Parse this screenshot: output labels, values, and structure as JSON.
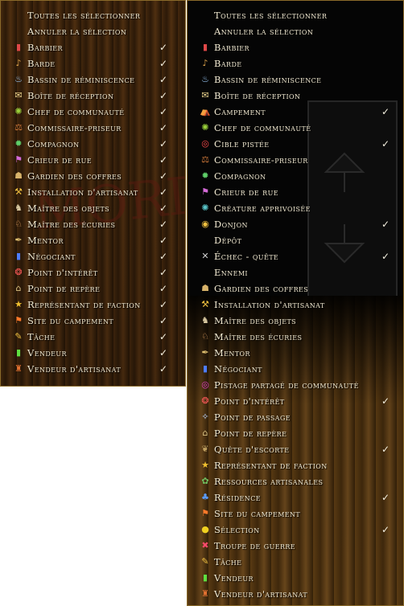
{
  "left_menu": {
    "watermark": "MORDOR",
    "items": [
      {
        "label": "Toutes les sélectionner",
        "icon": "none",
        "checked": false
      },
      {
        "label": "Annuler la sélection",
        "icon": "none",
        "checked": false
      },
      {
        "label": "Barbier",
        "icon": "barber-pole-icon",
        "checked": true
      },
      {
        "label": "Barde",
        "icon": "lute-icon",
        "checked": true
      },
      {
        "label": "Bassin de réminiscence",
        "icon": "reflecting-pool-icon",
        "checked": true
      },
      {
        "label": "Boîte de réception",
        "icon": "mailbox-icon",
        "checked": true
      },
      {
        "label": "Chef de communauté",
        "icon": "kinship-leader-icon",
        "checked": true
      },
      {
        "label": "Commissaire-priseur",
        "icon": "auctioneer-icon",
        "checked": true
      },
      {
        "label": "Compagnon",
        "icon": "companion-icon",
        "checked": true
      },
      {
        "label": "Crieur de rue",
        "icon": "town-crier-icon",
        "checked": true
      },
      {
        "label": "Gardien des coffres",
        "icon": "vault-keeper-icon",
        "checked": true
      },
      {
        "label": "Installation d'artisanat",
        "icon": "crafting-facility-icon",
        "checked": true
      },
      {
        "label": "Maître des objets",
        "icon": "item-master-icon",
        "checked": true
      },
      {
        "label": "Maître des écuries",
        "icon": "stable-master-icon",
        "checked": true
      },
      {
        "label": "Mentor",
        "icon": "mentor-icon",
        "checked": true
      },
      {
        "label": "Négociant",
        "icon": "merchant-icon",
        "checked": true
      },
      {
        "label": "Point d'intérêt",
        "icon": "point-of-interest-icon",
        "checked": true
      },
      {
        "label": "Point de repère",
        "icon": "landmark-icon",
        "checked": true
      },
      {
        "label": "Représentant de faction",
        "icon": "faction-star-icon",
        "checked": true
      },
      {
        "label": "Site du campement",
        "icon": "campsite-icon",
        "checked": true
      },
      {
        "label": "Tâche",
        "icon": "task-quill-icon",
        "checked": true
      },
      {
        "label": "Vendeur",
        "icon": "vendor-icon",
        "checked": true
      },
      {
        "label": "Vendeur d'artisanat",
        "icon": "crafting-vendor-icon",
        "checked": true
      }
    ]
  },
  "right_menu": {
    "items": [
      {
        "label": "Toutes les sélectionner",
        "icon": "none",
        "checked": false
      },
      {
        "label": "Annuler la sélection",
        "icon": "none",
        "checked": false
      },
      {
        "label": "Barbier",
        "icon": "barber-pole-icon",
        "checked": false
      },
      {
        "label": "Barde",
        "icon": "lute-icon",
        "checked": false
      },
      {
        "label": "Bassin de réminiscence",
        "icon": "reflecting-pool-icon",
        "checked": false
      },
      {
        "label": "Boîte de réception",
        "icon": "mailbox-icon",
        "checked": false
      },
      {
        "label": "Campement",
        "icon": "encampment-icon",
        "checked": true
      },
      {
        "label": "Chef de communauté",
        "icon": "kinship-leader-icon",
        "checked": false
      },
      {
        "label": "Cible pistée",
        "icon": "tracked-target-icon",
        "checked": true
      },
      {
        "label": "Commissaire-priseur",
        "icon": "auctioneer-icon",
        "checked": false
      },
      {
        "label": "Compagnon",
        "icon": "companion-icon",
        "checked": false
      },
      {
        "label": "Crieur de rue",
        "icon": "town-crier-icon",
        "checked": false
      },
      {
        "label": "Créature apprivoisée",
        "icon": "tamed-creature-icon",
        "checked": false
      },
      {
        "label": "Donjon",
        "icon": "dungeon-eye-icon",
        "checked": true
      },
      {
        "label": "Dépôt",
        "icon": "none",
        "checked": false
      },
      {
        "label": "Échec - quête",
        "icon": "quest-failed-icon",
        "checked": true
      },
      {
        "label": "Ennemi",
        "icon": "none",
        "checked": false
      },
      {
        "label": "Gardien des coffres",
        "icon": "vault-keeper-icon",
        "checked": false
      },
      {
        "label": "Installation d'artisanat",
        "icon": "crafting-facility-icon",
        "checked": false
      },
      {
        "label": "Maître des objets",
        "icon": "item-master-icon",
        "checked": false
      },
      {
        "label": "Maître des écuries",
        "icon": "stable-master-icon",
        "checked": false
      },
      {
        "label": "Mentor",
        "icon": "mentor-icon",
        "checked": false
      },
      {
        "label": "Négociant",
        "icon": "merchant-icon",
        "checked": false
      },
      {
        "label": "Pistage partagé de communauté",
        "icon": "shared-tracking-icon",
        "checked": false
      },
      {
        "label": "Point d'intérêt",
        "icon": "point-of-interest-icon",
        "checked": true
      },
      {
        "label": "Point de passage",
        "icon": "waypoint-icon",
        "checked": false
      },
      {
        "label": "Point de repère",
        "icon": "landmark-icon",
        "checked": false
      },
      {
        "label": "Quête d'escorte",
        "icon": "escort-quest-icon",
        "checked": true
      },
      {
        "label": "Représentant de faction",
        "icon": "faction-star-icon",
        "checked": false
      },
      {
        "label": "Ressources artisanales",
        "icon": "crafting-resources-icon",
        "checked": false
      },
      {
        "label": "Résidence",
        "icon": "residence-icon",
        "checked": true
      },
      {
        "label": "Site du campement",
        "icon": "campsite-icon",
        "checked": false
      },
      {
        "label": "Sélection",
        "icon": "selection-ring-icon",
        "checked": true
      },
      {
        "label": "Troupe de guerre",
        "icon": "warband-icon",
        "checked": false
      },
      {
        "label": "Tâche",
        "icon": "task-quill-icon",
        "checked": false
      },
      {
        "label": "Vendeur",
        "icon": "vendor-icon",
        "checked": false
      },
      {
        "label": "Vendeur d'artisanat",
        "icon": "crafting-vendor-icon",
        "checked": false
      }
    ]
  },
  "check_glyph": "✓",
  "colors": {
    "text": "#f2ead2",
    "border": "#8a6a2a",
    "dark": "#050505",
    "wood": "#5a3512"
  }
}
